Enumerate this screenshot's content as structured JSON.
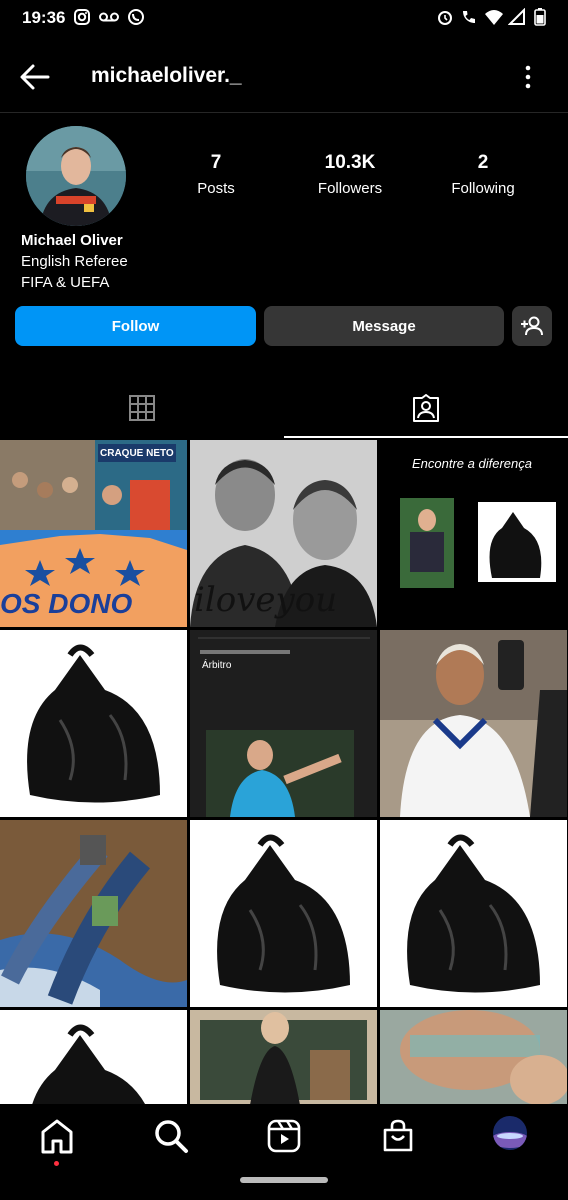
{
  "status_bar": {
    "time": "19:36"
  },
  "header": {
    "username": "michaeloliver._"
  },
  "profile": {
    "stats": [
      {
        "value": "7",
        "label": "Posts"
      },
      {
        "value": "10.3K",
        "label": "Followers"
      },
      {
        "value": "2",
        "label": "Following"
      }
    ],
    "name": "Michael Oliver",
    "bio_line1": "English Referee",
    "bio_line2": "FIFA & UEFA"
  },
  "actions": {
    "follow": "Follow",
    "message": "Message"
  },
  "posts": {
    "post1_banner_text": "CRAQUE NETO",
    "post1_bottom_text": "OS DONO",
    "post2_caption": "iloveyou",
    "post3_title": "Encontre a diferença",
    "post5_title": "Árbitro"
  },
  "colors": {
    "accent": "#0095f6",
    "secondary_button": "#363636",
    "background": "#000000"
  }
}
